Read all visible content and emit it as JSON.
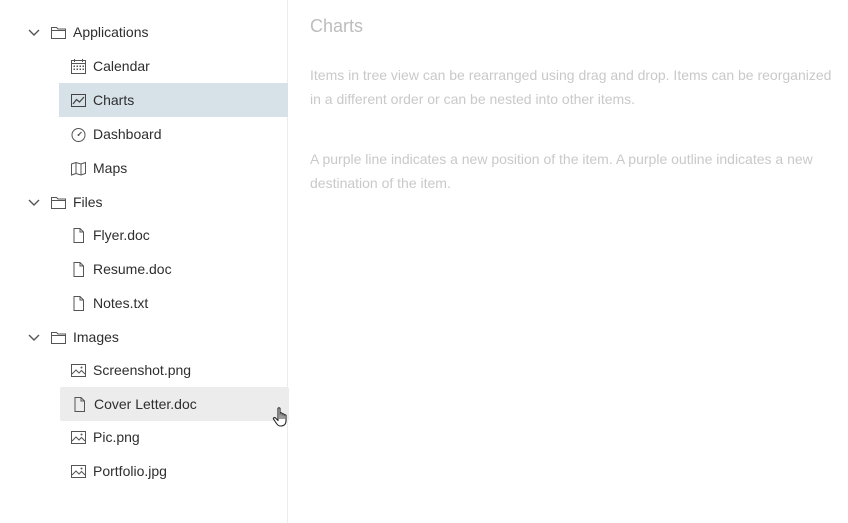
{
  "tree": {
    "groups": [
      {
        "label": "Applications",
        "items": [
          {
            "label": "Calendar",
            "icon": "calendar-icon"
          },
          {
            "label": "Charts",
            "icon": "chart-icon",
            "selected": true
          },
          {
            "label": "Dashboard",
            "icon": "dashboard-icon"
          },
          {
            "label": "Maps",
            "icon": "map-icon"
          }
        ]
      },
      {
        "label": "Files",
        "items": [
          {
            "label": "Flyer.doc",
            "icon": "file-icon"
          },
          {
            "label": "Resume.doc",
            "icon": "file-icon"
          },
          {
            "label": "Notes.txt",
            "icon": "file-icon"
          }
        ]
      },
      {
        "label": "Images",
        "items": [
          {
            "label": "Screenshot.png",
            "icon": "image-icon"
          },
          {
            "label": "Cover Letter.doc",
            "icon": "file-icon",
            "dragging": true
          },
          {
            "label": "Pic.png",
            "icon": "image-icon"
          },
          {
            "label": "Portfolio.jpg",
            "icon": "image-icon"
          }
        ]
      }
    ]
  },
  "content": {
    "title": "Charts",
    "paragraph1": "Items in tree view can be rearranged using drag and drop. Items can be reorganized in a different order or can be nested into other items.",
    "paragraph2": "A purple line indicates a new position of the item. A purple outline indicates a new destination of the item."
  },
  "colors": {
    "selected_bg": "#d6e1e8",
    "dragging_bg": "#ececec",
    "text": "#2e2e2e",
    "muted_text": "#c9c9c9"
  }
}
